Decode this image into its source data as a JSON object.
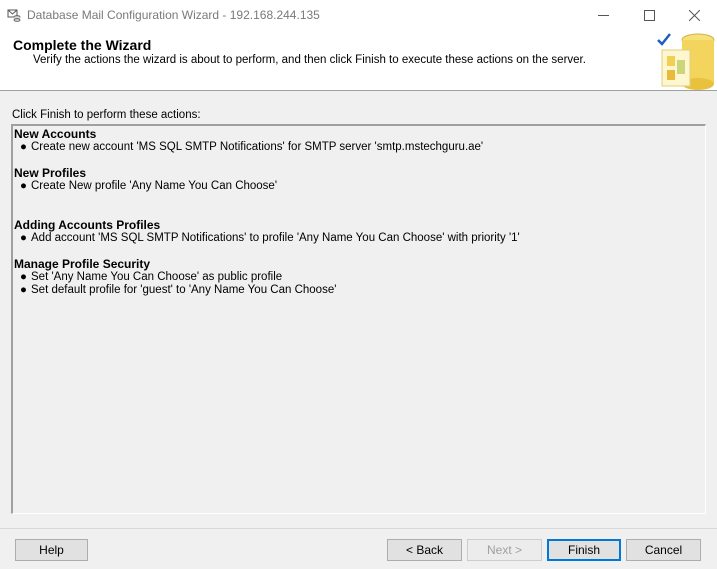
{
  "window": {
    "title": "Database Mail Configuration Wizard - 192.168.244.135"
  },
  "header": {
    "title": "Complete the Wizard",
    "subtitle": "Verify the actions the wizard is about to perform, and then click Finish to execute these actions on the server.",
    "icon": "database-mail-wizard-icon"
  },
  "main": {
    "instruction": "Click Finish to perform these actions:",
    "sections": [
      {
        "title": "New Accounts",
        "items": [
          "Create new account 'MS SQL SMTP Notifications' for SMTP server 'smtp.mstechguru.ae'"
        ]
      },
      {
        "title": "New Profiles",
        "items": [
          "Create New profile 'Any Name You Can Choose'"
        ]
      },
      {
        "title": "Adding Accounts Profiles",
        "items": [
          "Add account 'MS SQL SMTP Notifications' to profile 'Any Name You Can Choose' with priority '1'"
        ]
      },
      {
        "title": "Manage Profile Security",
        "items": [
          "Set 'Any Name You Can Choose' as public profile",
          "Set default profile for 'guest' to 'Any Name You Can Choose'"
        ]
      }
    ]
  },
  "buttons": {
    "help": "Help",
    "back": "< Back",
    "next": "Next >",
    "finish": "Finish",
    "cancel": "Cancel"
  },
  "colors": {
    "accent": "#0078d7",
    "dialog_bg": "#f0f0f0",
    "title_text": "#7a7a7a"
  }
}
